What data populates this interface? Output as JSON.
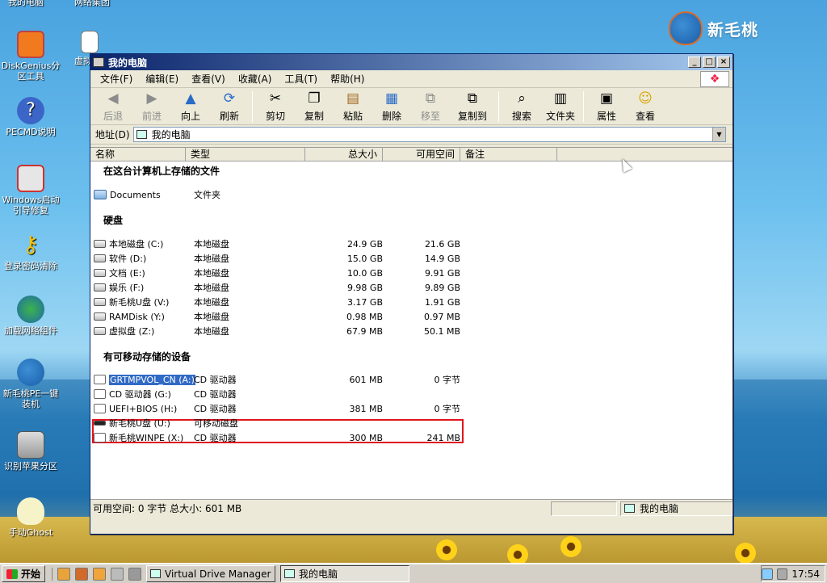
{
  "brand": "新毛桃",
  "desktop": {
    "top_labels": [
      "我的电脑",
      "网络集团"
    ],
    "icons": [
      {
        "label": "DiskGenius分\n区工具",
        "icon": "diskgenius-icon"
      },
      {
        "label": "PECMD说明",
        "icon": "help-icon"
      },
      {
        "label": "Windows启动\n引导修复",
        "icon": "boot-repair-icon"
      },
      {
        "label": "登录密码清除",
        "icon": "key-icon"
      },
      {
        "label": "加载网络组件",
        "icon": "network-icon"
      },
      {
        "label": "新毛桃PE一键\n装机",
        "icon": "installer-icon"
      },
      {
        "label": "识别苹果分区",
        "icon": "apple-partition-icon"
      },
      {
        "label": "手动Ghost",
        "icon": "ghost-icon"
      }
    ],
    "partial_icon_label": "虚拟"
  },
  "window": {
    "title": "我的电脑",
    "controls": {
      "minimize": "_",
      "maximize": "□",
      "close": "×"
    },
    "menu": [
      "文件(F)",
      "编辑(E)",
      "查看(V)",
      "收藏(A)",
      "工具(T)",
      "帮助(H)"
    ],
    "toolbar": [
      {
        "label": "后退",
        "icon": "back-arrow-icon",
        "enabled": false
      },
      {
        "label": "前进",
        "icon": "forward-arrow-icon",
        "enabled": false
      },
      {
        "label": "向上",
        "icon": "up-arrow-icon",
        "enabled": true
      },
      {
        "label": "刷新",
        "icon": "refresh-icon",
        "enabled": true
      },
      {
        "label": "剪切",
        "icon": "scissors-icon",
        "enabled": true
      },
      {
        "label": "复制",
        "icon": "copy-icon",
        "enabled": true
      },
      {
        "label": "粘贴",
        "icon": "paste-icon",
        "enabled": true
      },
      {
        "label": "删除",
        "icon": "delete-icon",
        "enabled": true
      },
      {
        "label": "移至",
        "icon": "move-to-icon",
        "enabled": false
      },
      {
        "label": "复制到",
        "icon": "copy-to-icon",
        "enabled": true
      },
      {
        "label": "搜索",
        "icon": "search-icon",
        "enabled": true
      },
      {
        "label": "文件夹",
        "icon": "folders-icon",
        "enabled": true
      },
      {
        "label": "属性",
        "icon": "properties-icon",
        "enabled": true
      },
      {
        "label": "查看",
        "icon": "views-icon",
        "enabled": true
      }
    ],
    "address": {
      "label": "地址(D)",
      "value": "我的电脑"
    },
    "columns": [
      "名称",
      "类型",
      "总大小",
      "可用空间",
      "备注"
    ],
    "groups": {
      "stored_files": "在这台计算机上存储的文件",
      "hard_disks": "硬盘",
      "removable": "有可移动存储的设备"
    },
    "stored_files": [
      {
        "name": "Documents",
        "type": "文件夹",
        "total": "",
        "free": ""
      }
    ],
    "hard_disks": [
      {
        "name": "本地磁盘 (C:)",
        "type": "本地磁盘",
        "total": "24.9 GB",
        "free": "21.6 GB"
      },
      {
        "name": "软件 (D:)",
        "type": "本地磁盘",
        "total": "15.0 GB",
        "free": "14.9 GB"
      },
      {
        "name": "文档 (E:)",
        "type": "本地磁盘",
        "total": "10.0 GB",
        "free": "9.91 GB"
      },
      {
        "name": "娱乐 (F:)",
        "type": "本地磁盘",
        "total": "9.98 GB",
        "free": "9.89 GB"
      },
      {
        "name": "新毛桃U盘 (V:)",
        "type": "本地磁盘",
        "total": "3.17 GB",
        "free": "1.91 GB"
      },
      {
        "name": "RAMDisk (Y:)",
        "type": "本地磁盘",
        "total": "0.98 MB",
        "free": "0.97 MB"
      },
      {
        "name": "虚拟盘 (Z:)",
        "type": "本地磁盘",
        "total": "67.9 MB",
        "free": "50.1 MB"
      }
    ],
    "removable": [
      {
        "name": "GRTMPVOL_CN (A:)",
        "type": "CD 驱动器",
        "total": "601 MB",
        "free": "0 字节",
        "selected": true
      },
      {
        "name": "CD 驱动器 (G:)",
        "type": "CD 驱动器",
        "total": "",
        "free": ""
      },
      {
        "name": "UEFI+BIOS (H:)",
        "type": "CD 驱动器",
        "total": "381 MB",
        "free": "0 字节"
      },
      {
        "name": "新毛桃U盘 (U:)",
        "type": "可移动磁盘",
        "total": "",
        "free": ""
      },
      {
        "name": "新毛桃WINPE (X:)",
        "type": "CD 驱动器",
        "total": "300 MB",
        "free": "241 MB"
      }
    ],
    "status": {
      "left": "可用空间: 0 字节 总大小: 601 MB",
      "right": "我的电脑"
    }
  },
  "taskbar": {
    "start": "开始",
    "tasks": [
      {
        "label": "Virtual Drive Manager",
        "active": false
      },
      {
        "label": "我的电脑",
        "active": true
      }
    ],
    "clock": "17:54"
  }
}
